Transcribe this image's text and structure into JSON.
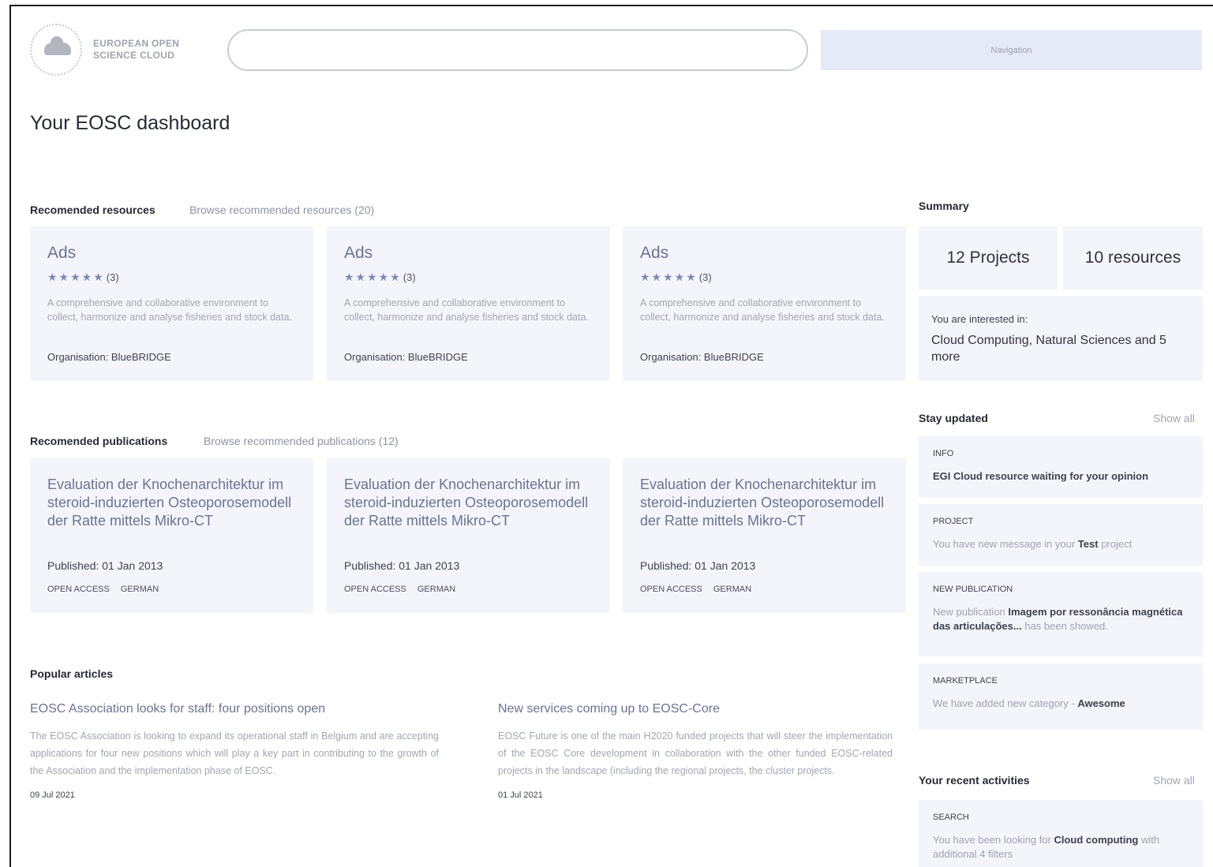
{
  "logo": {
    "line1": "EUROPEAN OPEN",
    "line2": "SCIENCE CLOUD"
  },
  "search": {
    "placeholder": ""
  },
  "nav": {
    "label": "Navigation"
  },
  "page_title": "Your EOSC dashboard",
  "resources": {
    "title": "Recomended resources",
    "browse": "Browse recommended resources (20)",
    "items": [
      {
        "title": "Ads",
        "stars": "★★★★★",
        "rating": "(3)",
        "description": "A comprehensive and collaborative environment to collect, harmonize and analyse fisheries and stock data.",
        "org": "Organisation: BlueBRIDGE"
      },
      {
        "title": "Ads",
        "stars": "★★★★★",
        "rating": "(3)",
        "description": "A comprehensive and collaborative environment to collect, harmonize and analyse fisheries and stock data.",
        "org": "Organisation: BlueBRIDGE"
      },
      {
        "title": "Ads",
        "stars": "★★★★★",
        "rating": "(3)",
        "description": "A comprehensive and collaborative environment to collect, harmonize and analyse fisheries and stock data.",
        "org": "Organisation: BlueBRIDGE"
      }
    ]
  },
  "publications": {
    "title": "Recomended publications",
    "browse": "Browse recommended publications (12)",
    "items": [
      {
        "title": "Evaluation der Knochenarchitektur im steroid-induzierten Osteoporosemodell der Ratte mittels Mikro-CT",
        "published": "Published: 01 Jan 2013",
        "tag1": "OPEN ACCESS",
        "tag2": "GERMAN"
      },
      {
        "title": "Evaluation der Knochenarchitektur im steroid-induzierten Osteoporosemodell der Ratte mittels Mikro-CT",
        "published": "Published: 01 Jan 2013",
        "tag1": "OPEN ACCESS",
        "tag2": "GERMAN"
      },
      {
        "title": "Evaluation der Knochenarchitektur im steroid-induzierten Osteoporosemodell der Ratte mittels Mikro-CT",
        "published": "Published: 01 Jan 2013",
        "tag1": "OPEN ACCESS",
        "tag2": "GERMAN"
      }
    ]
  },
  "articles": {
    "title": "Popular articles",
    "items": [
      {
        "title": "EOSC Association looks for staff: four positions open",
        "text": "The EOSC Association is looking to expand its operational staff in Belgium and are accepting applications for four new positions which will play a key part in contributing to the growth of the Association and the implementation phase of EOSC.",
        "date": "09 Jul 2021"
      },
      {
        "title": "New services coming up to EOSC-Core",
        "text": "EOSC Future is one of the main H2020 funded projects that will steer the implementation of the EOSC Core development in collaboration with the other funded EOSC-related projects in the landscape (including the regional projects, the cluster projects.",
        "date": "01 Jul 2021"
      }
    ]
  },
  "summary": {
    "title": "Summary",
    "projects": "12 Projects",
    "resources": "10 resources",
    "interested_label": "You are interested in:",
    "interested_text": "Cloud Computing, Natural Sciences and 5 more"
  },
  "stay_updated": {
    "title": "Stay updated",
    "show_all": "Show all",
    "items": [
      {
        "category": "INFO",
        "pre": "",
        "bold": "EGI Cloud resource waiting for your opinion",
        "post": ""
      },
      {
        "category": "PROJECT",
        "pre": "You have new message in your ",
        "bold": "Test",
        "post": " project"
      },
      {
        "category": "NEW PUBLICATION",
        "pre": "New publication ",
        "bold": "Imagem por ressonância magnética das articulações...",
        "post": " has been showed."
      },
      {
        "category": "MARKETPLACE",
        "pre": "We have added new category - ",
        "bold": "Awesome",
        "post": ""
      }
    ]
  },
  "recent": {
    "title": "Your recent activities",
    "show_all": "Show all",
    "items": [
      {
        "category": "SEARCH",
        "pre": "You have been looking for ",
        "bold": "Cloud computing",
        "post": " with additional 4 filters"
      }
    ]
  }
}
